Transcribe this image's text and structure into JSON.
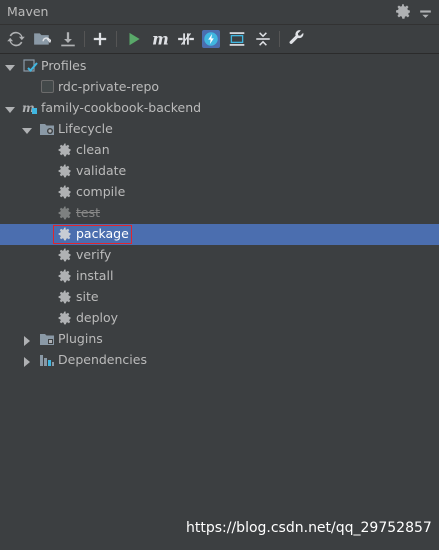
{
  "window": {
    "title": "Maven"
  },
  "tree": {
    "profiles": {
      "label": "Profiles",
      "items": [
        {
          "label": "rdc-private-repo",
          "checked": false
        }
      ]
    },
    "project": {
      "label": "family-cookbook-backend"
    },
    "lifecycle": {
      "label": "Lifecycle",
      "goals": [
        "clean",
        "validate",
        "compile",
        "test",
        "package",
        "verify",
        "install",
        "site",
        "deploy"
      ],
      "disabled_goal": "test",
      "selected_goal": "package"
    },
    "plugins": {
      "label": "Plugins"
    },
    "dependencies": {
      "label": "Dependencies"
    }
  },
  "watermark": "https://blog.csdn.net/qq_29752857",
  "colors": {
    "background": "#3c3f41",
    "selection": "#4b6eaf",
    "text": "#bbbbbb",
    "highlight_border": "#e0262d",
    "run_green": "#59a869"
  }
}
